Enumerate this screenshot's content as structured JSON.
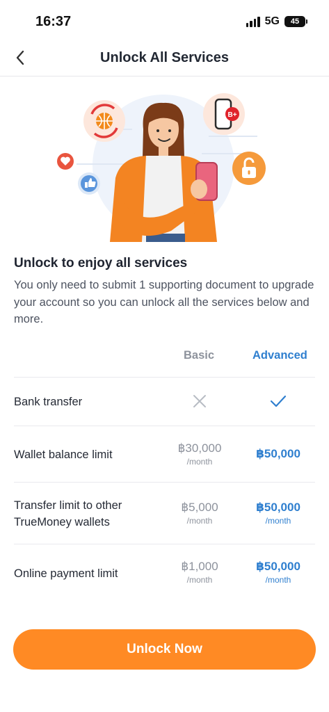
{
  "status_bar": {
    "time": "16:37",
    "network": "5G",
    "battery": "45"
  },
  "header": {
    "title": "Unlock All Services",
    "back_icon": "chevron-left-icon"
  },
  "intro": {
    "title": "Unlock to enjoy all services",
    "description": "You only need to submit 1 supporting document to upgrade your account so you can unlock all the services below and more."
  },
  "comparison": {
    "columns": {
      "basic": "Basic",
      "advanced": "Advanced"
    },
    "rows": [
      {
        "label": "Bank transfer",
        "basic_icon": "cross-icon",
        "advanced_icon": "check-icon"
      },
      {
        "label": "Wallet balance limit",
        "basic": "฿30,000",
        "basic_unit": "/month",
        "advanced": "฿50,000"
      },
      {
        "label": "Transfer limit to other TrueMoney wallets",
        "basic": "฿5,000",
        "basic_unit": "/month",
        "advanced": "฿50,000",
        "advanced_unit": "/month"
      },
      {
        "label": "Online payment limit",
        "basic": "฿1,000",
        "basic_unit": "/month",
        "advanced": "฿50,000",
        "advanced_unit": "/month"
      }
    ]
  },
  "illustration": {
    "badge_text": "B+",
    "icons": [
      "globe-exchange-icon",
      "phone-icon",
      "heart-icon",
      "thumbs-up-icon",
      "unlock-icon"
    ]
  },
  "cta": {
    "label": "Unlock Now"
  },
  "colors": {
    "accent_orange": "#ff8a24",
    "advanced_blue": "#2f7fcf",
    "muted_gray": "#8d929c"
  }
}
